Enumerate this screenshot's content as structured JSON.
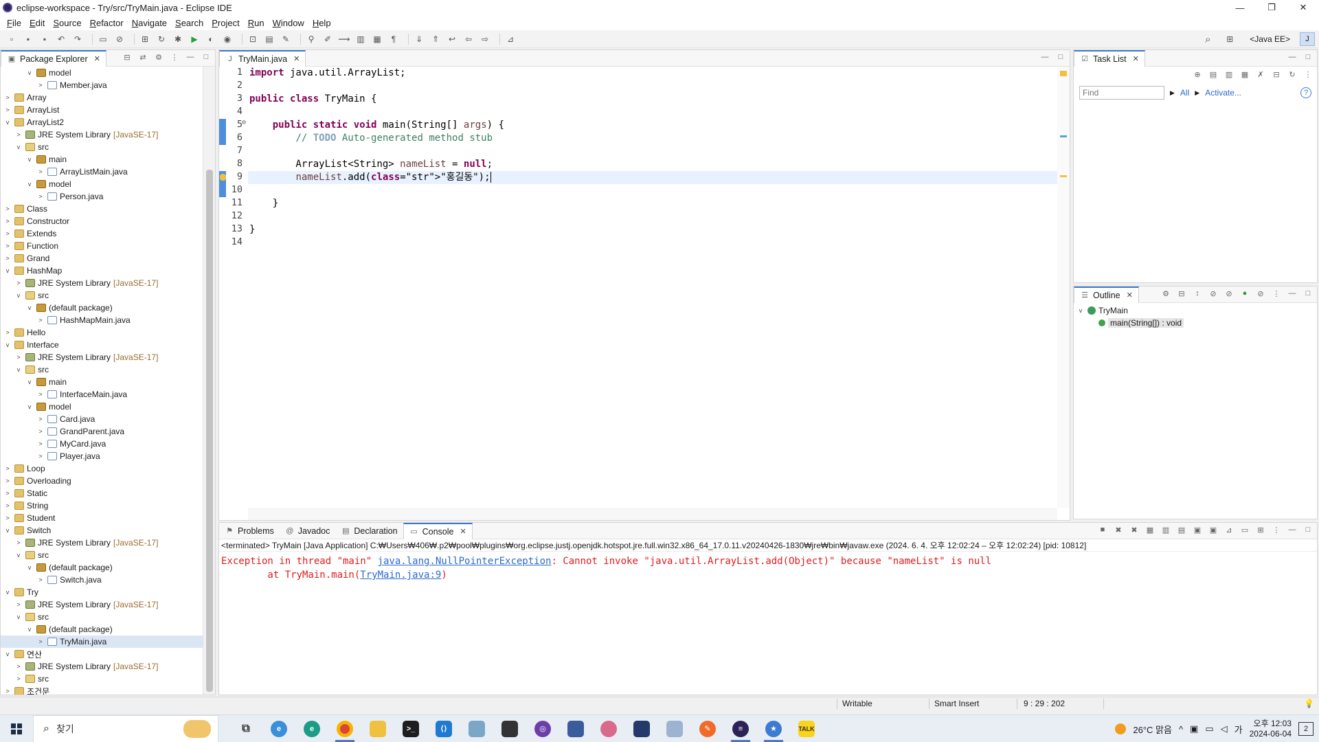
{
  "window": {
    "title": "eclipse-workspace - Try/src/TryMain.java - Eclipse IDE",
    "controls": {
      "minimize": "—",
      "restore": "❐",
      "close": "✕"
    }
  },
  "menu": [
    "File",
    "Edit",
    "Source",
    "Refactor",
    "Navigate",
    "Search",
    "Project",
    "Run",
    "Window",
    "Help"
  ],
  "toolbar": {
    "perspective": "<Java EE>"
  },
  "package_explorer": {
    "title": "Package Explorer",
    "rows": [
      {
        "indent": 2,
        "tw": "v",
        "icon": "pkg",
        "label": "model"
      },
      {
        "indent": 3,
        "tw": ">",
        "icon": "file",
        "label": "Member.java"
      },
      {
        "indent": 0,
        "tw": ">",
        "icon": "proj",
        "label": "Array"
      },
      {
        "indent": 0,
        "tw": ">",
        "icon": "proj",
        "label": "ArrayList"
      },
      {
        "indent": 0,
        "tw": "v",
        "icon": "proj",
        "label": "ArrayList2"
      },
      {
        "indent": 1,
        "tw": ">",
        "icon": "jre",
        "label": "JRE System Library",
        "suffix": "[JavaSE-17]"
      },
      {
        "indent": 1,
        "tw": "v",
        "icon": "src",
        "label": "src"
      },
      {
        "indent": 2,
        "tw": "v",
        "icon": "pkg",
        "label": "main"
      },
      {
        "indent": 3,
        "tw": ">",
        "icon": "file",
        "label": "ArrayListMain.java"
      },
      {
        "indent": 2,
        "tw": "v",
        "icon": "pkg",
        "label": "model"
      },
      {
        "indent": 3,
        "tw": ">",
        "icon": "file",
        "label": "Person.java"
      },
      {
        "indent": 0,
        "tw": ">",
        "icon": "proj",
        "label": "Class"
      },
      {
        "indent": 0,
        "tw": ">",
        "icon": "proj",
        "label": "Constructor"
      },
      {
        "indent": 0,
        "tw": ">",
        "icon": "proj",
        "label": "Extends"
      },
      {
        "indent": 0,
        "tw": ">",
        "icon": "proj",
        "label": "Function"
      },
      {
        "indent": 0,
        "tw": ">",
        "icon": "proj",
        "label": "Grand"
      },
      {
        "indent": 0,
        "tw": "v",
        "icon": "proj",
        "label": "HashMap"
      },
      {
        "indent": 1,
        "tw": ">",
        "icon": "jre",
        "label": "JRE System Library",
        "suffix": "[JavaSE-17]"
      },
      {
        "indent": 1,
        "tw": "v",
        "icon": "src",
        "label": "src"
      },
      {
        "indent": 2,
        "tw": "v",
        "icon": "pkg",
        "label": "(default package)"
      },
      {
        "indent": 3,
        "tw": ">",
        "icon": "file",
        "label": "HashMapMain.java"
      },
      {
        "indent": 0,
        "tw": ">",
        "icon": "proj",
        "label": "Hello"
      },
      {
        "indent": 0,
        "tw": "v",
        "icon": "proj",
        "label": "Interface"
      },
      {
        "indent": 1,
        "tw": ">",
        "icon": "jre",
        "label": "JRE System Library",
        "suffix": "[JavaSE-17]"
      },
      {
        "indent": 1,
        "tw": "v",
        "icon": "src",
        "label": "src"
      },
      {
        "indent": 2,
        "tw": "v",
        "icon": "pkg",
        "label": "main"
      },
      {
        "indent": 3,
        "tw": ">",
        "icon": "file",
        "label": "InterfaceMain.java"
      },
      {
        "indent": 2,
        "tw": "v",
        "icon": "pkg",
        "label": "model"
      },
      {
        "indent": 3,
        "tw": ">",
        "icon": "file",
        "label": "Card.java"
      },
      {
        "indent": 3,
        "tw": ">",
        "icon": "file",
        "label": "GrandParent.java"
      },
      {
        "indent": 3,
        "tw": ">",
        "icon": "file",
        "label": "MyCard.java"
      },
      {
        "indent": 3,
        "tw": ">",
        "icon": "file",
        "label": "Player.java"
      },
      {
        "indent": 0,
        "tw": ">",
        "icon": "proj",
        "label": "Loop"
      },
      {
        "indent": 0,
        "tw": ">",
        "icon": "proj",
        "label": "Overloading"
      },
      {
        "indent": 0,
        "tw": ">",
        "icon": "proj",
        "label": "Static"
      },
      {
        "indent": 0,
        "tw": ">",
        "icon": "proj",
        "label": "String"
      },
      {
        "indent": 0,
        "tw": ">",
        "icon": "proj",
        "label": "Student"
      },
      {
        "indent": 0,
        "tw": "v",
        "icon": "proj",
        "label": "Switch"
      },
      {
        "indent": 1,
        "tw": ">",
        "icon": "jre",
        "label": "JRE System Library",
        "suffix": "[JavaSE-17]"
      },
      {
        "indent": 1,
        "tw": "v",
        "icon": "src",
        "label": "src"
      },
      {
        "indent": 2,
        "tw": "v",
        "icon": "pkg",
        "label": "(default package)"
      },
      {
        "indent": 3,
        "tw": ">",
        "icon": "file",
        "label": "Switch.java"
      },
      {
        "indent": 0,
        "tw": "v",
        "icon": "proj",
        "label": "Try"
      },
      {
        "indent": 1,
        "tw": ">",
        "icon": "jre",
        "label": "JRE System Library",
        "suffix": "[JavaSE-17]"
      },
      {
        "indent": 1,
        "tw": "v",
        "icon": "src",
        "label": "src"
      },
      {
        "indent": 2,
        "tw": "v",
        "icon": "pkg",
        "label": "(default package)"
      },
      {
        "indent": 3,
        "tw": ">",
        "icon": "file",
        "label": "TryMain.java",
        "selected": true
      },
      {
        "indent": 0,
        "tw": "v",
        "icon": "proj",
        "label": "연산"
      },
      {
        "indent": 1,
        "tw": ">",
        "icon": "jre",
        "label": "JRE System Library",
        "suffix": "[JavaSE-17]"
      },
      {
        "indent": 1,
        "tw": ">",
        "icon": "src",
        "label": "src"
      },
      {
        "indent": 0,
        "tw": ">",
        "icon": "proj",
        "label": "조건문"
      }
    ]
  },
  "editor": {
    "tab": "TryMain.java",
    "lines": [
      "import java.util.ArrayList;",
      "",
      "public class TryMain {",
      "",
      "    public static void main(String[] args) {",
      "        // TODO Auto-generated method stub",
      "",
      "        ArrayList<String> nameList = null;",
      "        nameList.add(\"홍길동\");",
      "",
      "    }",
      "",
      "}",
      ""
    ],
    "fold_marker": "⊖"
  },
  "console": {
    "tabs": [
      "Problems",
      "Javadoc",
      "Declaration",
      "Console"
    ],
    "description": "<terminated> TryMain [Java Application] C:₩Users₩406₩.p2₩pool₩plugins₩org.eclipse.justj.openjdk.hotspot.jre.full.win32.x86_64_17.0.11.v20240426-1830₩jre₩bin₩javaw.exe  (2024. 6. 4. 오후 12:02:24 – 오후 12:02:24) [pid: 10812]",
    "line1_prefix": "Exception in thread \"main\" ",
    "line1_link": "java.lang.NullPointerException",
    "line1_suffix": ": Cannot invoke \"java.util.ArrayList.add(Object)\" because \"nameList\" is null",
    "line2_prefix": "        at TryMain.main(",
    "line2_link": "TryMain.java:9",
    "line2_suffix": ")"
  },
  "task_list": {
    "title": "Task List",
    "find_placeholder": "Find",
    "all_label": "All",
    "activate_label": "Activate..."
  },
  "outline": {
    "title": "Outline",
    "class_name": "TryMain",
    "method": "main(String[]) : void"
  },
  "status": {
    "writable": "Writable",
    "insert_mode": "Smart Insert",
    "position": "9 : 29 : 202"
  },
  "taskbar": {
    "search_placeholder": "찾기",
    "weather": "26°C  맑음",
    "ime": "가",
    "time": "오후 12:03",
    "date": "2024-06-04",
    "notifications": "2"
  },
  "colors": {
    "accent": "#3c7bd1",
    "keyword": "#7f0055",
    "comment": "#3f7f5f",
    "string": "#2a00ff",
    "error": "#e01b1b"
  }
}
